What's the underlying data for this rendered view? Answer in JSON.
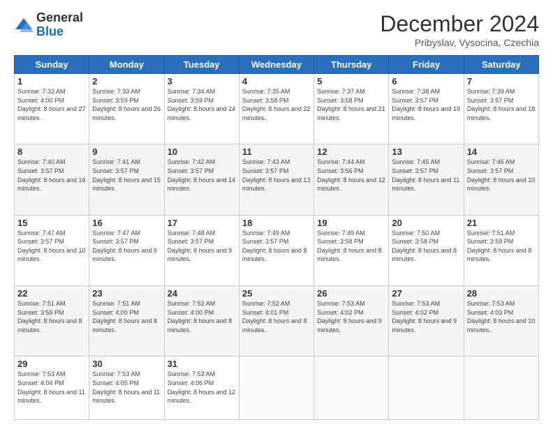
{
  "logo": {
    "general": "General",
    "blue": "Blue"
  },
  "header": {
    "month": "December 2024",
    "location": "Pribyslav, Vysocina, Czechia"
  },
  "weekdays": [
    "Sunday",
    "Monday",
    "Tuesday",
    "Wednesday",
    "Thursday",
    "Friday",
    "Saturday"
  ],
  "weeks": [
    [
      {
        "day": "1",
        "sunrise": "7:32 AM",
        "sunset": "4:00 PM",
        "daylight": "8 hours and 27 minutes."
      },
      {
        "day": "2",
        "sunrise": "7:33 AM",
        "sunset": "3:59 PM",
        "daylight": "8 hours and 26 minutes."
      },
      {
        "day": "3",
        "sunrise": "7:34 AM",
        "sunset": "3:59 PM",
        "daylight": "8 hours and 24 minutes."
      },
      {
        "day": "4",
        "sunrise": "7:35 AM",
        "sunset": "3:58 PM",
        "daylight": "8 hours and 22 minutes."
      },
      {
        "day": "5",
        "sunrise": "7:37 AM",
        "sunset": "3:58 PM",
        "daylight": "8 hours and 21 minutes."
      },
      {
        "day": "6",
        "sunrise": "7:38 AM",
        "sunset": "3:57 PM",
        "daylight": "8 hours and 19 minutes."
      },
      {
        "day": "7",
        "sunrise": "7:39 AM",
        "sunset": "3:57 PM",
        "daylight": "8 hours and 18 minutes."
      }
    ],
    [
      {
        "day": "8",
        "sunrise": "7:40 AM",
        "sunset": "3:57 PM",
        "daylight": "8 hours and 16 minutes."
      },
      {
        "day": "9",
        "sunrise": "7:41 AM",
        "sunset": "3:57 PM",
        "daylight": "8 hours and 15 minutes."
      },
      {
        "day": "10",
        "sunrise": "7:42 AM",
        "sunset": "3:57 PM",
        "daylight": "8 hours and 14 minutes."
      },
      {
        "day": "11",
        "sunrise": "7:43 AM",
        "sunset": "3:57 PM",
        "daylight": "8 hours and 13 minutes."
      },
      {
        "day": "12",
        "sunrise": "7:44 AM",
        "sunset": "3:56 PM",
        "daylight": "8 hours and 12 minutes."
      },
      {
        "day": "13",
        "sunrise": "7:45 AM",
        "sunset": "3:57 PM",
        "daylight": "8 hours and 11 minutes."
      },
      {
        "day": "14",
        "sunrise": "7:46 AM",
        "sunset": "3:57 PM",
        "daylight": "8 hours and 10 minutes."
      }
    ],
    [
      {
        "day": "15",
        "sunrise": "7:47 AM",
        "sunset": "3:57 PM",
        "daylight": "8 hours and 10 minutes."
      },
      {
        "day": "16",
        "sunrise": "7:47 AM",
        "sunset": "3:57 PM",
        "daylight": "8 hours and 9 minutes."
      },
      {
        "day": "17",
        "sunrise": "7:48 AM",
        "sunset": "3:57 PM",
        "daylight": "8 hours and 9 minutes."
      },
      {
        "day": "18",
        "sunrise": "7:49 AM",
        "sunset": "3:57 PM",
        "daylight": "8 hours and 8 minutes."
      },
      {
        "day": "19",
        "sunrise": "7:49 AM",
        "sunset": "3:58 PM",
        "daylight": "8 hours and 8 minutes."
      },
      {
        "day": "20",
        "sunrise": "7:50 AM",
        "sunset": "3:58 PM",
        "daylight": "8 hours and 8 minutes."
      },
      {
        "day": "21",
        "sunrise": "7:51 AM",
        "sunset": "3:59 PM",
        "daylight": "8 hours and 8 minutes."
      }
    ],
    [
      {
        "day": "22",
        "sunrise": "7:51 AM",
        "sunset": "3:59 PM",
        "daylight": "8 hours and 8 minutes."
      },
      {
        "day": "23",
        "sunrise": "7:51 AM",
        "sunset": "4:00 PM",
        "daylight": "8 hours and 8 minutes."
      },
      {
        "day": "24",
        "sunrise": "7:52 AM",
        "sunset": "4:00 PM",
        "daylight": "8 hours and 8 minutes."
      },
      {
        "day": "25",
        "sunrise": "7:52 AM",
        "sunset": "4:01 PM",
        "daylight": "8 hours and 8 minutes."
      },
      {
        "day": "26",
        "sunrise": "7:53 AM",
        "sunset": "4:02 PM",
        "daylight": "8 hours and 9 minutes."
      },
      {
        "day": "27",
        "sunrise": "7:53 AM",
        "sunset": "4:02 PM",
        "daylight": "8 hours and 9 minutes."
      },
      {
        "day": "28",
        "sunrise": "7:53 AM",
        "sunset": "4:03 PM",
        "daylight": "8 hours and 10 minutes."
      }
    ],
    [
      {
        "day": "29",
        "sunrise": "7:53 AM",
        "sunset": "4:04 PM",
        "daylight": "8 hours and 11 minutes."
      },
      {
        "day": "30",
        "sunrise": "7:53 AM",
        "sunset": "4:05 PM",
        "daylight": "8 hours and 11 minutes."
      },
      {
        "day": "31",
        "sunrise": "7:53 AM",
        "sunset": "4:06 PM",
        "daylight": "8 hours and 12 minutes."
      },
      null,
      null,
      null,
      null
    ]
  ],
  "labels": {
    "sunrise": "Sunrise:",
    "sunset": "Sunset:",
    "daylight": "Daylight:"
  }
}
